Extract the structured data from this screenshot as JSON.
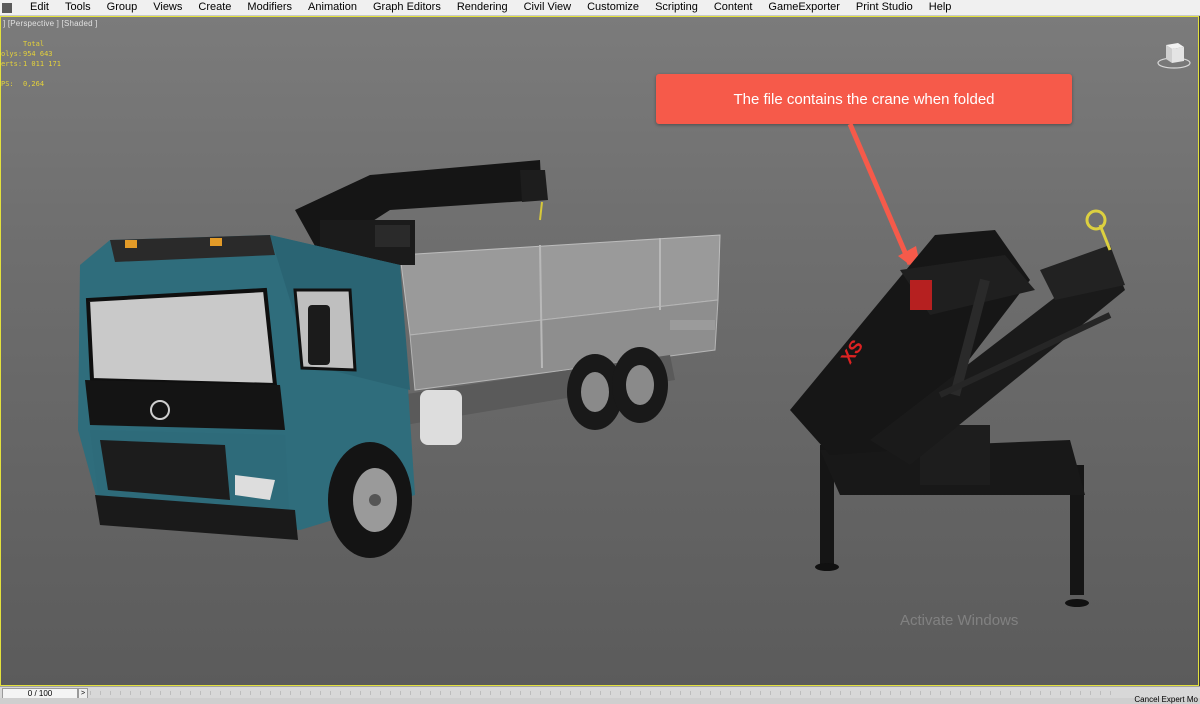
{
  "menubar": {
    "items": [
      "Edit",
      "Tools",
      "Group",
      "Views",
      "Create",
      "Modifiers",
      "Animation",
      "Graph Editors",
      "Rendering",
      "Civil View",
      "Customize",
      "Scripting",
      "Content",
      "GameExporter",
      "Print Studio",
      "Help"
    ]
  },
  "viewport": {
    "label": "] [Perspective ] [Shaded ]",
    "stats": {
      "header": "Total",
      "rows": [
        {
          "key": "olys:",
          "value": "954 643"
        },
        {
          "key": "erts:",
          "value": "1 011 171"
        },
        {
          "key": "PS:",
          "value": "0,264"
        }
      ]
    },
    "callout_text": "The file contains the crane when folded",
    "watermark_text": "Activate Windows"
  },
  "timeline": {
    "frame_label": "0 / 100",
    "next_label": ">"
  },
  "statusbar": {
    "cancel_label": "Cancel Expert Mo"
  },
  "colors": {
    "viewport_border": "#e3e13c",
    "callout": "#f65a4a",
    "truck_cab": "#2f6d7c",
    "crane": "#1a1a1a"
  }
}
